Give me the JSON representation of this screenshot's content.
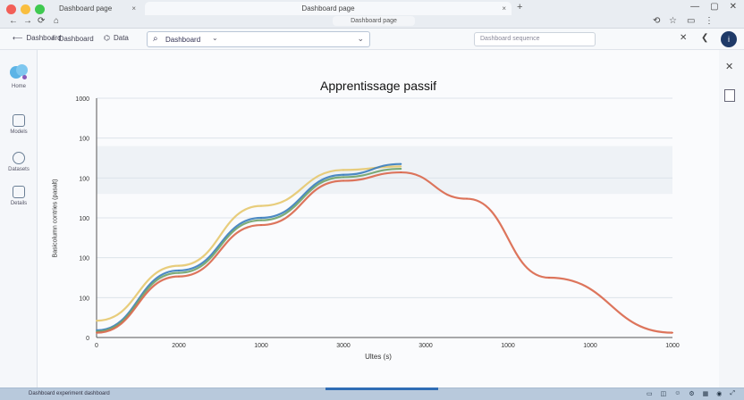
{
  "window": {
    "tabs": [
      {
        "label": "Dashboard page"
      },
      {
        "label": "Dashboard page"
      }
    ],
    "url": "Dashboard page"
  },
  "toolbar": {
    "item1": "Dashboard",
    "item2": "Dashboard",
    "item3": "Data",
    "search_value": "Dashboard",
    "filter_placeholder": "Dashboard sequence",
    "avatar_initial": "i"
  },
  "sidebar": {
    "items": [
      {
        "label": "Home",
        "icon": "app-logo-icon"
      },
      {
        "label": "Models",
        "icon": "chart-icon"
      },
      {
        "label": "Datasets",
        "icon": "settings-icon"
      },
      {
        "label": "Details",
        "icon": "file-icon"
      }
    ]
  },
  "statusbar": {
    "text": "Dashboard experiment dashboard"
  },
  "chart_data": {
    "type": "line",
    "title": "Apprentissage passif",
    "xlabel": "Ultes (s)",
    "ylabel": "Basicolumn contries (pasalt)",
    "x_ticks": [
      "0",
      "2000",
      "1000",
      "3000",
      "3000",
      "1000",
      "1000",
      "1000"
    ],
    "y_ticks": [
      "0",
      "100",
      "100",
      "100",
      "100",
      "100",
      "1000"
    ],
    "x": [
      0,
      1,
      2,
      3,
      4,
      5,
      6,
      7
    ],
    "ylim": [
      0,
      1000
    ],
    "grid": true,
    "series": [
      {
        "color": "#e6c86e",
        "x": [
          0,
          1,
          2,
          3,
          3.7
        ],
        "values": [
          70,
          300,
          550,
          700,
          715
        ]
      },
      {
        "color": "#3a7dbd",
        "x": [
          0,
          1,
          2,
          3,
          3.7
        ],
        "values": [
          30,
          280,
          500,
          680,
          725
        ]
      },
      {
        "color": "#6fa36a",
        "x": [
          0,
          1,
          2,
          3,
          3.7
        ],
        "values": [
          25,
          270,
          490,
          670,
          705
        ]
      },
      {
        "color": "#d9664a",
        "x": [
          0,
          1,
          2,
          3,
          3.7,
          4.5,
          5.5,
          7
        ],
        "values": [
          20,
          255,
          470,
          655,
          690,
          580,
          250,
          20
        ]
      }
    ]
  }
}
